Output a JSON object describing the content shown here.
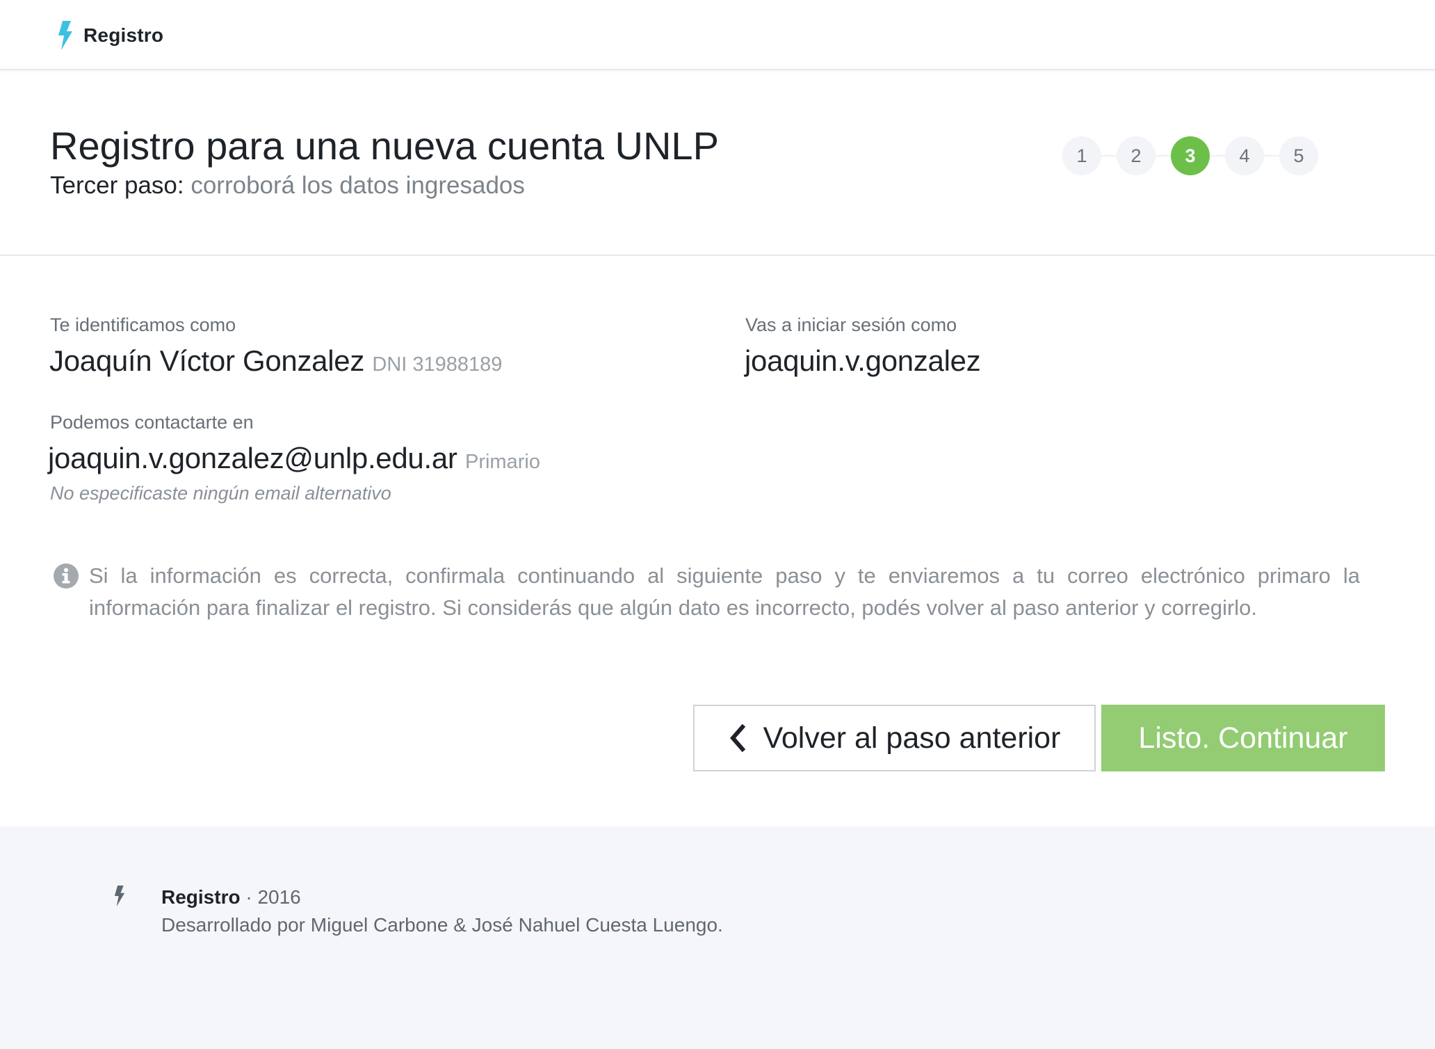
{
  "navbar": {
    "brand": "Registro",
    "brand_icon": "bolt-icon",
    "accent": "#3ec1e0"
  },
  "header": {
    "title": "Registro para una nueva cuenta UNLP",
    "step_prefix": "Tercer paso:",
    "step_text": "corroborá los datos ingresados",
    "steps": [
      "1",
      "2",
      "3",
      "4",
      "5"
    ],
    "active_step": 3,
    "active_color": "#6cc04a"
  },
  "identity": {
    "label": "Te identificamos como",
    "name": "Joaquín Víctor Gonzalez",
    "doc": "DNI 31988189"
  },
  "login": {
    "label": "Vas a iniciar sesión como",
    "username": "joaquin.v.gonzalez"
  },
  "contact": {
    "label": "Podemos contactarte en",
    "email": "joaquin.v.gonzalez@unlp.edu.ar",
    "email_tag": "Primario",
    "alt_note": "No especificaste ningún email alternativo"
  },
  "info": {
    "icon": "info-icon",
    "text": "Si la información es correcta, confirmala continuando al siguiente paso y te enviaremos a tu correo electrónico primaro la información para finalizar el registro. Si considerás que algún dato es incorrecto, podés volver al paso anterior y corregirlo."
  },
  "actions": {
    "back_label": "Volver al paso anterior",
    "continue_label": "Listo. Continuar",
    "continue_color": "#93cc73"
  },
  "footer": {
    "brand": "Registro",
    "year": " · 2016",
    "credits": "Desarrollado por Miguel Carbone & José Nahuel Cuesta Luengo."
  }
}
